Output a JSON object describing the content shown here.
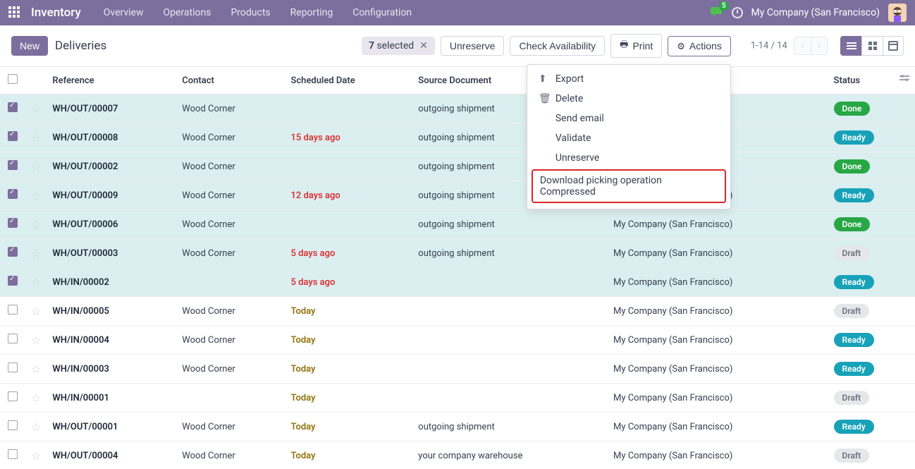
{
  "navbar": {
    "app_title": "Inventory",
    "menu": [
      "Overview",
      "Operations",
      "Products",
      "Reporting",
      "Configuration"
    ],
    "chat_count": "5",
    "company": "My Company (San Francisco)"
  },
  "control": {
    "new_label": "New",
    "breadcrumb": "Deliveries",
    "selection": {
      "count": "7",
      "label": "selected"
    },
    "buttons": {
      "unreserve": "Unreserve",
      "check_avail": "Check Availability",
      "print": "Print",
      "actions": "Actions"
    },
    "pager": "1-14 / 14"
  },
  "dropdown": {
    "export": "Export",
    "delete": "Delete",
    "send_email": "Send email",
    "validate": "Validate",
    "unreserve": "Unreserve",
    "download_compressed": "Download picking operation Compressed"
  },
  "columns": {
    "reference": "Reference",
    "contact": "Contact",
    "scheduled_date": "Scheduled Date",
    "source_doc": "Source Document",
    "company": "",
    "status": "Status"
  },
  "status_labels": {
    "done": "Done",
    "ready": "Ready",
    "draft": "Draft"
  },
  "rows": [
    {
      "sel": true,
      "ref": "WH/OUT/00007",
      "contact": "Wood Corner",
      "date": "",
      "date_cls": "",
      "src": "outgoing shipment",
      "company": "",
      "status": "done"
    },
    {
      "sel": true,
      "ref": "WH/OUT/00008",
      "contact": "Wood Corner",
      "date": "15 days ago",
      "date_cls": "date-red",
      "src": "outgoing shipment",
      "company": "",
      "status": "ready"
    },
    {
      "sel": true,
      "ref": "WH/OUT/00002",
      "contact": "Wood Corner",
      "date": "",
      "date_cls": "",
      "src": "outgoing shipment",
      "company": "",
      "status": "done"
    },
    {
      "sel": true,
      "ref": "WH/OUT/00009",
      "contact": "Wood Corner",
      "date": "12 days ago",
      "date_cls": "date-red",
      "src": "outgoing shipment",
      "company": "My Company (San Francisco)",
      "status": "ready"
    },
    {
      "sel": true,
      "ref": "WH/OUT/00006",
      "contact": "Wood Corner",
      "date": "",
      "date_cls": "",
      "src": "outgoing shipment",
      "company": "My Company (San Francisco)",
      "status": "done"
    },
    {
      "sel": true,
      "ref": "WH/OUT/00003",
      "contact": "Wood Corner",
      "date": "5 days ago",
      "date_cls": "date-red",
      "src": "outgoing shipment",
      "company": "My Company (San Francisco)",
      "status": "draft"
    },
    {
      "sel": true,
      "ref": "WH/IN/00002",
      "contact": "",
      "date": "5 days ago",
      "date_cls": "date-red",
      "src": "",
      "company": "My Company (San Francisco)",
      "status": "ready"
    },
    {
      "sel": false,
      "ref": "WH/IN/00005",
      "contact": "Wood Corner",
      "date": "Today",
      "date_cls": "date-today",
      "src": "",
      "company": "My Company (San Francisco)",
      "status": "draft"
    },
    {
      "sel": false,
      "ref": "WH/IN/00004",
      "contact": "Wood Corner",
      "date": "Today",
      "date_cls": "date-today",
      "src": "",
      "company": "My Company (San Francisco)",
      "status": "ready"
    },
    {
      "sel": false,
      "ref": "WH/IN/00003",
      "contact": "Wood Corner",
      "date": "Today",
      "date_cls": "date-today",
      "src": "",
      "company": "My Company (San Francisco)",
      "status": "ready"
    },
    {
      "sel": false,
      "ref": "WH/IN/00001",
      "contact": "",
      "date": "Today",
      "date_cls": "date-today",
      "src": "",
      "company": "My Company (San Francisco)",
      "status": "draft"
    },
    {
      "sel": false,
      "ref": "WH/OUT/00001",
      "contact": "Wood Corner",
      "date": "Today",
      "date_cls": "date-today",
      "src": "outgoing shipment",
      "company": "My Company (San Francisco)",
      "status": "ready"
    },
    {
      "sel": false,
      "ref": "WH/OUT/00004",
      "contact": "Wood Corner",
      "date": "Today",
      "date_cls": "date-today",
      "src": "your company warehouse",
      "company": "My Company (San Francisco)",
      "status": "draft"
    }
  ]
}
